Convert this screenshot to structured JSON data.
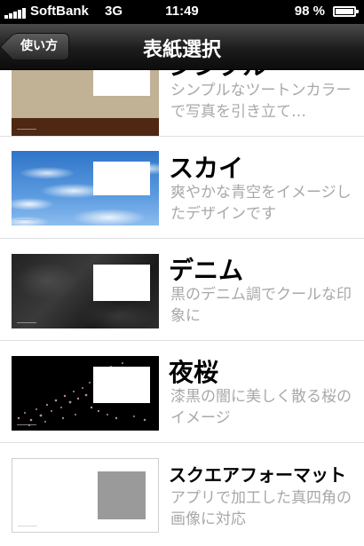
{
  "status_bar": {
    "carrier": "SoftBank",
    "network": "3G",
    "time": "11:49",
    "battery": "98 %",
    "battery_level": 0.98
  },
  "nav": {
    "back_label": "使い方",
    "title": "表紙選択"
  },
  "covers": [
    {
      "title": "シンプル",
      "description": "シンプルなツートンカラーで写真を引き立て…"
    },
    {
      "title": "スカイ",
      "description": "爽やかな青空をイメージしたデザインです"
    },
    {
      "title": "デニム",
      "description": "黒のデニム調でクールな印象に"
    },
    {
      "title": "夜桜",
      "description": "漆黒の闇に美しく散る桜のイメージ"
    },
    {
      "title": "スクエアフォーマット",
      "description": "アプリで加工した真四角の画像に対応"
    }
  ]
}
